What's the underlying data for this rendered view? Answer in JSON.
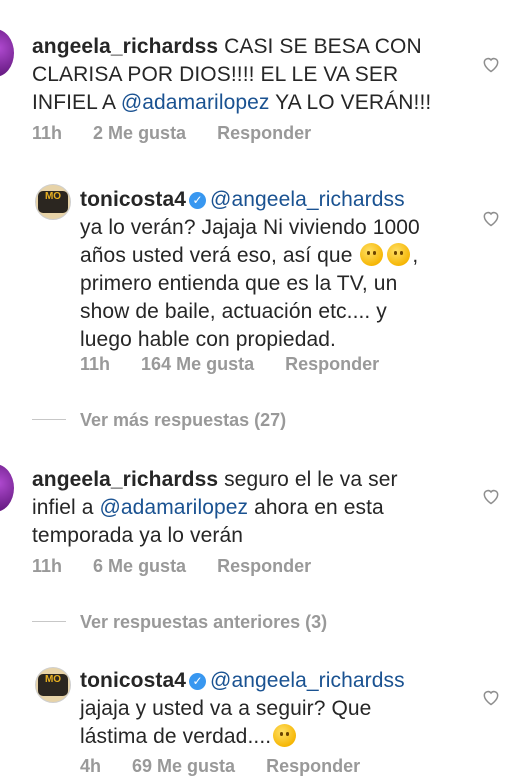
{
  "comments": [
    {
      "username": "angeela_richardss",
      "line1": " CASI SE BESA CON",
      "line2": "CLARISA POR DIOS!!!! EL LE VA SER",
      "line3_pre": "INFIEL A ",
      "line3_mention": "@adamarilopez",
      "line3_post": " YA LO VERÁN!!!",
      "time": "11h",
      "likes": "2 Me gusta",
      "reply": "Responder"
    },
    {
      "username": "tonicosta4",
      "mention": "@angeela_richardss",
      "line2": "ya lo verán? Jajaja Ni viviendo 1000",
      "line3": "años usted verá eso, así que ",
      "line3_end": ",",
      "line4": "primero entienda que es la TV, un",
      "line5": "show de baile, actuación etc.... y",
      "line6": "luego hable con propiedad.",
      "time": "11h",
      "likes": "164 Me gusta",
      "reply": "Responder"
    },
    {
      "more_replies": "Ver más respuestas (27)"
    },
    {
      "username": "angeela_richardss",
      "line1": " seguro el le va ser",
      "line2_pre": "infiel a ",
      "line2_mention": "@adamarilopez",
      "line2_post": "  ahora en esta",
      "line3": "temporada ya lo verán",
      "time": "11h",
      "likes": "6 Me gusta",
      "reply": "Responder"
    },
    {
      "previous_replies": "Ver respuestas anteriores (3)"
    },
    {
      "username": "tonicosta4",
      "mention": "@angeela_richardss",
      "line2": "jajaja y usted va a seguir? Que",
      "line3": "lástima de verdad....",
      "time": "4h",
      "likes": "69 Me gusta",
      "reply": "Responder"
    }
  ],
  "avatar_logo_text": "MO",
  "icons": {
    "heart": "heart-outline-icon",
    "verified": "verified-badge-icon",
    "emoji": "smiley-emoji-icon"
  },
  "colors": {
    "mention": "#1a5291",
    "meta": "#999999",
    "verified": "#3897f0"
  }
}
